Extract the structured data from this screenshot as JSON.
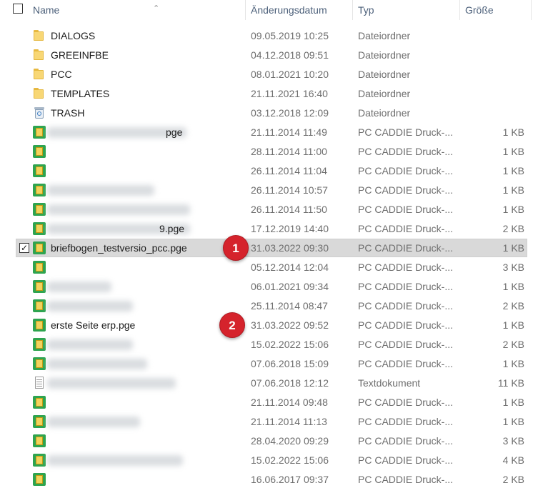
{
  "header": {
    "name_label": "Name",
    "date_label": "Änderungsdatum",
    "type_label": "Typ",
    "size_label": "Größe"
  },
  "rows": [
    {
      "kind": "folder",
      "name": "DIALOGS",
      "date": "09.05.2019 10:25",
      "type": "Dateiordner",
      "size": ""
    },
    {
      "kind": "folder",
      "name": "GREEINFBE",
      "date": "04.12.2018 09:51",
      "type": "Dateiordner",
      "size": ""
    },
    {
      "kind": "folder",
      "name": "PCC",
      "date": "08.01.2021 10:20",
      "type": "Dateiordner",
      "size": ""
    },
    {
      "kind": "folder",
      "name": "TEMPLATES",
      "date": "21.11.2021 16:40",
      "type": "Dateiordner",
      "size": ""
    },
    {
      "kind": "trash",
      "name": "TRASH",
      "date": "03.12.2018 12:09",
      "type": "Dateiordner",
      "size": ""
    },
    {
      "kind": "pge",
      "name": "pge",
      "date": "21.11.2014 11:49",
      "type": "PC CADDIE Druck-...",
      "size": "1 KB"
    },
    {
      "kind": "pge",
      "name": "",
      "date": "28.11.2014 11:00",
      "type": "PC CADDIE Druck-...",
      "size": "1 KB"
    },
    {
      "kind": "pge",
      "name": "",
      "date": "26.11.2014 11:04",
      "type": "PC CADDIE Druck-...",
      "size": "1 KB"
    },
    {
      "kind": "pge",
      "name": "",
      "date": "26.11.2014 10:57",
      "type": "PC CADDIE Druck-...",
      "size": "1 KB"
    },
    {
      "kind": "pge",
      "name": "",
      "date": "26.11.2014 11:50",
      "type": "PC CADDIE Druck-...",
      "size": "1 KB"
    },
    {
      "kind": "pge",
      "name": "9.pge",
      "date": "17.12.2019 14:40",
      "type": "PC CADDIE Druck-...",
      "size": "2 KB"
    },
    {
      "kind": "pge",
      "name": "briefbogen_testversio_pcc.pge",
      "date": "31.03.2022 09:30",
      "type": "PC CADDIE Druck-...",
      "size": "1 KB",
      "selected": true,
      "badge": "1"
    },
    {
      "kind": "pge",
      "name": "",
      "date": "05.12.2014 12:04",
      "type": "PC CADDIE Druck-...",
      "size": "3 KB"
    },
    {
      "kind": "pge",
      "name": "",
      "date": "06.01.2021 09:34",
      "type": "PC CADDIE Druck-...",
      "size": "1 KB"
    },
    {
      "kind": "pge",
      "name": "",
      "date": "25.11.2014 08:47",
      "type": "PC CADDIE Druck-...",
      "size": "2 KB"
    },
    {
      "kind": "pge",
      "name": "erste Seite erp.pge",
      "date": "31.03.2022 09:52",
      "type": "PC CADDIE Druck-...",
      "size": "1 KB",
      "badge": "2"
    },
    {
      "kind": "pge",
      "name": "",
      "date": "15.02.2022 15:06",
      "type": "PC CADDIE Druck-...",
      "size": "2 KB"
    },
    {
      "kind": "pge",
      "name": "",
      "date": "07.06.2018 15:09",
      "type": "PC CADDIE Druck-...",
      "size": "1 KB"
    },
    {
      "kind": "txt",
      "name": "",
      "date": "07.06.2018 12:12",
      "type": "Textdokument",
      "size": "11 KB"
    },
    {
      "kind": "pge",
      "name": "",
      "date": "21.11.2014 09:48",
      "type": "PC CADDIE Druck-...",
      "size": "1 KB"
    },
    {
      "kind": "pge",
      "name": "",
      "date": "21.11.2014 11:13",
      "type": "PC CADDIE Druck-...",
      "size": "1 KB"
    },
    {
      "kind": "pge",
      "name": "",
      "date": "28.04.2020 09:29",
      "type": "PC CADDIE Druck-...",
      "size": "3 KB"
    },
    {
      "kind": "pge",
      "name": "",
      "date": "15.02.2022 15:06",
      "type": "PC CADDIE Druck-...",
      "size": "4 KB"
    },
    {
      "kind": "pge",
      "name": "",
      "date": "16.06.2017 09:37",
      "type": "PC CADDIE Druck-...",
      "size": "2 KB"
    }
  ]
}
